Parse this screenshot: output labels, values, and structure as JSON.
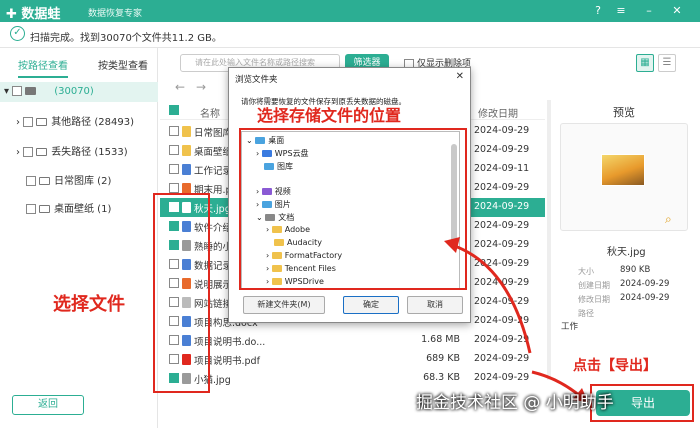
{
  "app": {
    "title": "数据蛙",
    "subtitle": "数据恢复专家"
  },
  "scan": {
    "status": "扫描完成。找到30070个文件共11.2 GB。"
  },
  "left": {
    "tabs": [
      "按路径查看",
      "按类型查看"
    ],
    "root": "(30070)",
    "items": [
      {
        "label": "其他路径 (28493)"
      },
      {
        "label": "丢失路径 (1533)"
      },
      {
        "label": "日常图库 (2)"
      },
      {
        "label": "桌面壁纸 (1)"
      }
    ],
    "back_label": "返回"
  },
  "toolbar": {
    "search_placeholder": "请在此处输入文件名称或路径搜索",
    "filter_label": "筛选器",
    "only_deleted": "仅显示删除项"
  },
  "table": {
    "headers": {
      "name": "名称",
      "date": "修改日期"
    },
    "rows": [
      {
        "name": "日常图库",
        "size": "",
        "date": "2024-09-29",
        "icon": "#f0c24c",
        "checked": false,
        "sel": false
      },
      {
        "name": "桌面壁纸",
        "size": "",
        "date": "2024-09-29",
        "icon": "#f0c24c",
        "checked": false,
        "sel": false
      },
      {
        "name": "工作记录1",
        "size": "",
        "date": "2024-09-11",
        "icon": "#4a7fd4",
        "checked": false,
        "sel": false
      },
      {
        "name": "期末用.ppt",
        "size": "",
        "date": "2024-09-29",
        "icon": "#e86a2c",
        "checked": false,
        "sel": false
      },
      {
        "name": "秋天.jpg",
        "size": "",
        "date": "2024-09-29",
        "icon": "#ffffff",
        "checked": true,
        "sel": true
      },
      {
        "name": "软件介绍 -",
        "size": "",
        "date": "2024-09-29",
        "icon": "#4a7fd4",
        "checked": true,
        "sel": false
      },
      {
        "name": "熟睡的小猫",
        "size": "",
        "date": "2024-09-29",
        "icon": "#9a9a9a",
        "checked": true,
        "sel": false
      },
      {
        "name": "数据记录",
        "size": "",
        "date": "2024-09-29",
        "icon": "#4a7fd4",
        "checked": false,
        "sel": false
      },
      {
        "name": "说明展示.p",
        "size": "",
        "date": "2024-09-29",
        "icon": "#e86a2c",
        "checked": false,
        "sel": false
      },
      {
        "name": "网站链接.t",
        "size": "",
        "date": "2024-09-29",
        "icon": "#bbbbbb",
        "checked": false,
        "sel": false
      },
      {
        "name": "项目构思.docx",
        "size": "",
        "date": "2024-09-29",
        "icon": "#4a7fd4",
        "checked": false,
        "sel": false
      },
      {
        "name": "项目说明书.do...",
        "size": "1.68 MB",
        "date": "2024-09-29",
        "icon": "#4a7fd4",
        "checked": false,
        "sel": false
      },
      {
        "name": "项目说明书.pdf",
        "size": "689 KB",
        "date": "2024-09-29",
        "icon": "#e0281e",
        "checked": false,
        "sel": false
      },
      {
        "name": "小猫.jpg",
        "size": "68.3 KB",
        "date": "2024-09-29",
        "icon": "#9a9a9a",
        "checked": true,
        "sel": false
      }
    ]
  },
  "preview": {
    "title": "预览",
    "filename": "秋天.jpg",
    "meta": [
      {
        "label": "大小",
        "value": "890 KB"
      },
      {
        "label": "创建日期",
        "value": "2024-09-29"
      },
      {
        "label": "修改日期",
        "value": "2024-09-29"
      },
      {
        "label": "路径",
        "value": ""
      }
    ],
    "path_value": "工作",
    "export_label": "导出"
  },
  "dialog": {
    "title": "浏览文件夹",
    "description": "请你将需要恢复的文件保存到原丢失数据的磁盘。",
    "tree": [
      "桌面",
      "WPS云盘",
      "图库",
      "视频",
      "图片",
      "文档",
      "Adobe",
      "Audacity",
      "FormatFactory",
      "Tencent Files",
      "WPSDrive"
    ],
    "new_folder": "新建文件夹(M)",
    "ok": "确定",
    "cancel": "取消"
  },
  "annotations": {
    "select_location": "选择存储文件的位置",
    "select_files": "选择文件",
    "click_export": "点击【导出】"
  },
  "watermark": "掘金技术社区 @ 小明助手"
}
